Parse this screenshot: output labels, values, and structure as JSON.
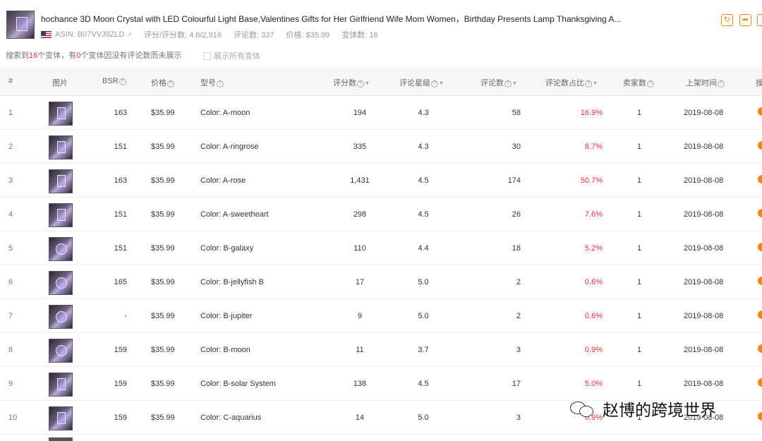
{
  "product": {
    "title": "hochance 3D Moon Crystal with LED Colourful Light Base,Valentines Gifts for Her Girlfriend Wife Mom Women，Birthday Presents Lamp Thanksgiving A...",
    "asin": "ASIN: B07VVJ9ZLD",
    "rating": "评分/评分数: 4.6/2,916",
    "reviews": "评论数: 337",
    "price": "价格: $35.99",
    "variants": "变体数: 16"
  },
  "summary": {
    "prefix": "搜索到",
    "count": "16",
    "middle": "个变体，有",
    "zero": "0",
    "suffix": "个变体因没有评论数而未展示",
    "checkbox_label": "展示所有变体"
  },
  "columns": {
    "index": "#",
    "image": "图片",
    "bsr": "BSR",
    "price": "价格",
    "model": "型号",
    "rating_count": "评分数",
    "stars": "评论星级",
    "review_count": "评论数",
    "review_ratio": "评论数占比",
    "sellers": "卖家数",
    "listed": "上架时间",
    "action": "操"
  },
  "rows": [
    {
      "idx": "1",
      "bsr": "163",
      "price": "$35.99",
      "model": "Color: A-moon",
      "ratings": "194",
      "stars": "4.3",
      "reviews": "58",
      "ratio": "16.9%",
      "sellers": "1",
      "date": "2019-08-08"
    },
    {
      "idx": "2",
      "bsr": "151",
      "price": "$35.99",
      "model": "Color: A-ringrose",
      "ratings": "335",
      "stars": "4.3",
      "reviews": "30",
      "ratio": "8.7%",
      "sellers": "1",
      "date": "2019-08-08"
    },
    {
      "idx": "3",
      "bsr": "163",
      "price": "$35.99",
      "model": "Color: A-rose",
      "ratings": "1,431",
      "stars": "4.5",
      "reviews": "174",
      "ratio": "50.7%",
      "sellers": "1",
      "date": "2019-08-08"
    },
    {
      "idx": "4",
      "bsr": "151",
      "price": "$35.99",
      "model": "Color: A-sweetheart",
      "ratings": "298",
      "stars": "4.5",
      "reviews": "26",
      "ratio": "7.6%",
      "sellers": "1",
      "date": "2019-08-08"
    },
    {
      "idx": "5",
      "bsr": "151",
      "price": "$35.99",
      "model": "Color: B-galaxy",
      "ratings": "110",
      "stars": "4.4",
      "reviews": "18",
      "ratio": "5.2%",
      "sellers": "1",
      "date": "2019-08-08"
    },
    {
      "idx": "6",
      "bsr": "165",
      "price": "$35.99",
      "model": "Color: B-jellyfish B",
      "ratings": "17",
      "stars": "5.0",
      "reviews": "2",
      "ratio": "0.6%",
      "sellers": "1",
      "date": "2019-08-08"
    },
    {
      "idx": "7",
      "bsr": "-",
      "price": "$35.99",
      "model": "Color: B-jupiter",
      "ratings": "9",
      "stars": "5.0",
      "reviews": "2",
      "ratio": "0.6%",
      "sellers": "1",
      "date": "2019-08-08"
    },
    {
      "idx": "8",
      "bsr": "159",
      "price": "$35.99",
      "model": "Color: B-moon",
      "ratings": "11",
      "stars": "3.7",
      "reviews": "3",
      "ratio": "0.9%",
      "sellers": "1",
      "date": "2019-08-08"
    },
    {
      "idx": "9",
      "bsr": "159",
      "price": "$35.99",
      "model": "Color: B-solar System",
      "ratings": "138",
      "stars": "4.5",
      "reviews": "17",
      "ratio": "5.0%",
      "sellers": "1",
      "date": "2019-08-08"
    },
    {
      "idx": "10",
      "bsr": "159",
      "price": "$35.99",
      "model": "Color: C-aquarius",
      "ratings": "14",
      "stars": "5.0",
      "reviews": "3",
      "ratio": "0.9%",
      "sellers": "1",
      "date": "2019-08-08"
    }
  ],
  "watermark": "赵博的跨境世界",
  "icons": {
    "refresh": "refresh-icon",
    "share": "share-icon",
    "external_link": "external-link-icon",
    "flag": "us-flag-icon"
  },
  "colors": {
    "accent": "#f08519",
    "negative": "#ef3030"
  }
}
